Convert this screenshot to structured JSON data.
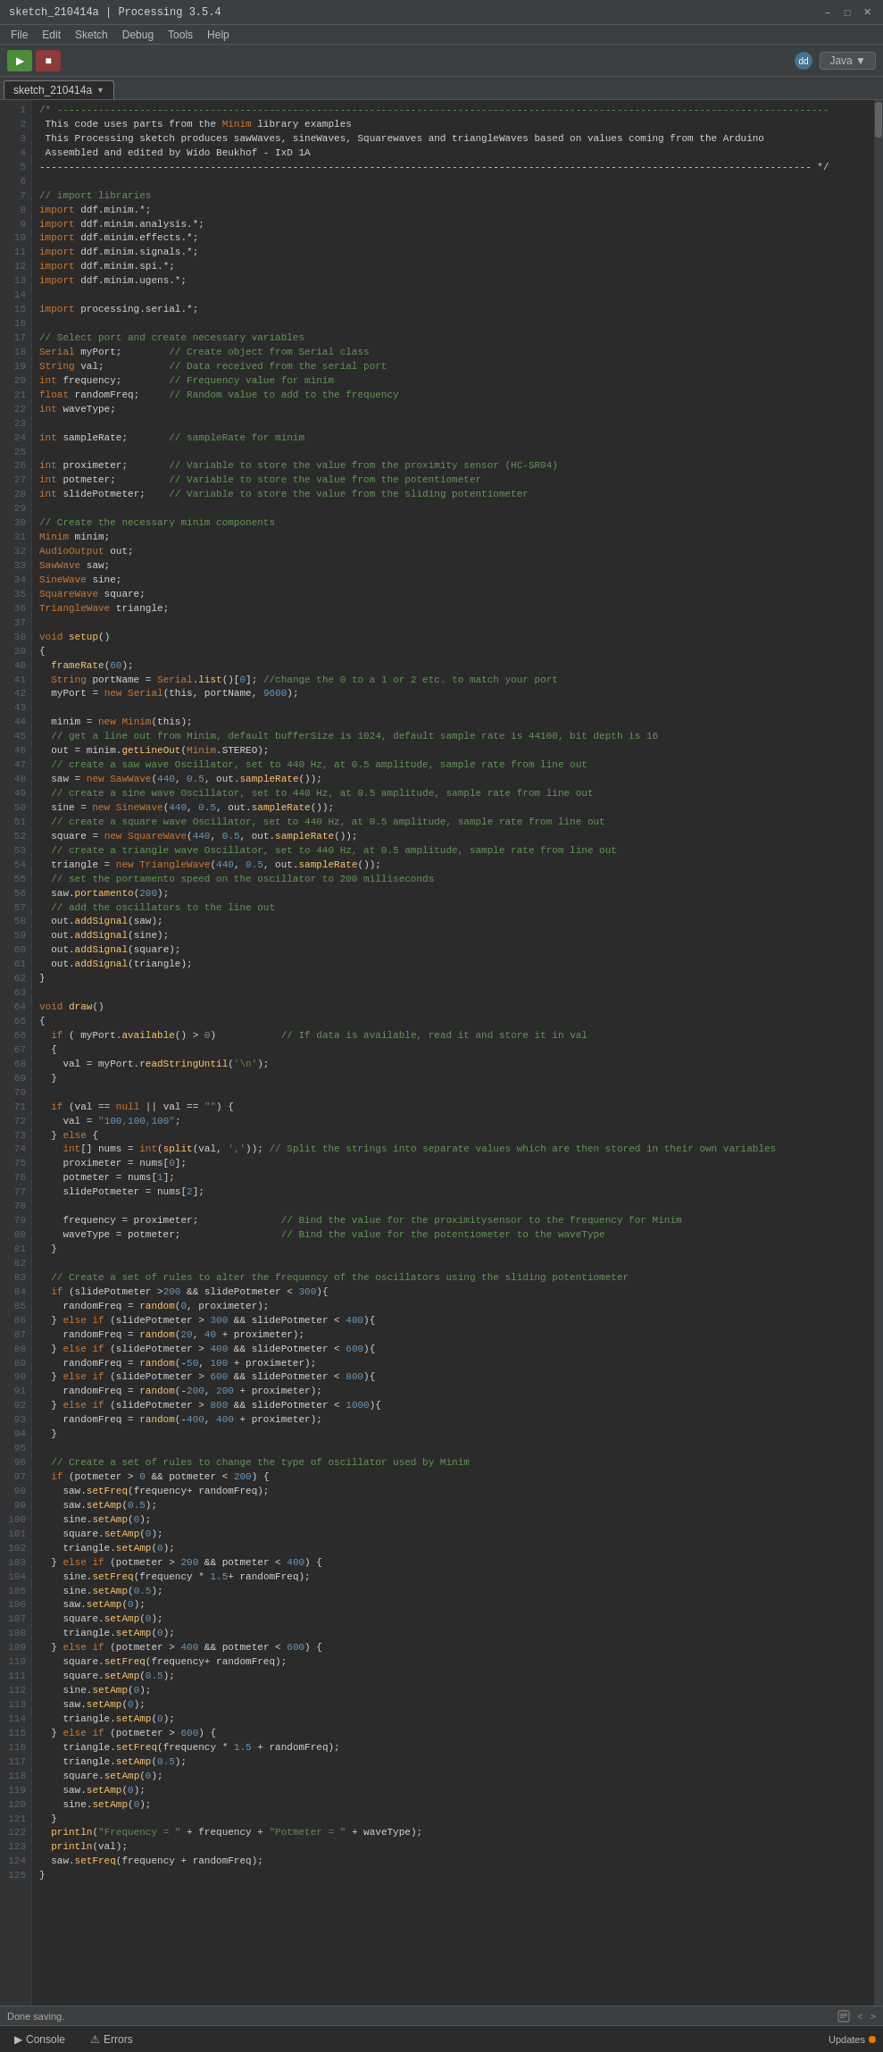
{
  "titlebar": {
    "title": "sketch_210414a | Processing 3.5.4",
    "minimize": "−",
    "maximize": "□",
    "close": "✕"
  },
  "menubar": {
    "items": [
      "File",
      "Edit",
      "Sketch",
      "Debug",
      "Tools",
      "Help"
    ]
  },
  "toolbar": {
    "run_label": "▶",
    "stop_label": "■",
    "java_label": "Java ▼"
  },
  "tab": {
    "name": "sketch_210414a",
    "dropdown": "▼"
  },
  "status": {
    "text": "Done saving."
  },
  "bottom": {
    "console_label": "Console",
    "errors_label": "Errors",
    "updates_label": "Updates"
  },
  "code_lines": [
    {
      "n": 1,
      "text": "/* -----------------------------------------------------------------------------------------------------------------------------------"
    },
    {
      "n": 2,
      "text": " This code uses parts from the Minim library examples"
    },
    {
      "n": 3,
      "text": " This Processing sketch produces sawWaves, sineWaves, Squarewaves and triangleWaves based on values coming from the Arduino"
    },
    {
      "n": 4,
      "text": " Assembled and edited by Wido Beukhof - IxD 1A"
    },
    {
      "n": 5,
      "text": "----------------------------------------------------------------------------------------------------------------------------------- */"
    },
    {
      "n": 6,
      "text": ""
    },
    {
      "n": 7,
      "text": "// import libraries"
    },
    {
      "n": 8,
      "text": "import ddf.minim.*;"
    },
    {
      "n": 9,
      "text": "import ddf.minim.analysis.*;"
    },
    {
      "n": 10,
      "text": "import ddf.minim.effects.*;"
    },
    {
      "n": 11,
      "text": "import ddf.minim.signals.*;"
    },
    {
      "n": 12,
      "text": "import ddf.minim.spi.*;"
    },
    {
      "n": 13,
      "text": "import ddf.minim.ugens.*;"
    },
    {
      "n": 14,
      "text": ""
    },
    {
      "n": 15,
      "text": "import processing.serial.*;"
    },
    {
      "n": 16,
      "text": ""
    },
    {
      "n": 17,
      "text": "// Select port and create necessary variables"
    },
    {
      "n": 18,
      "text": "Serial myPort;        // Create object from Serial class"
    },
    {
      "n": 19,
      "text": "String val;           // Data received from the serial port"
    },
    {
      "n": 20,
      "text": "int frequency;        // Frequency value for minim"
    },
    {
      "n": 21,
      "text": "float randomFreq;     // Random value to add to the frequency"
    },
    {
      "n": 22,
      "text": "int waveType;"
    },
    {
      "n": 23,
      "text": ""
    },
    {
      "n": 24,
      "text": "int sampleRate;       // sampleRate for minim"
    },
    {
      "n": 25,
      "text": ""
    },
    {
      "n": 26,
      "text": "int proximeter;       // Variable to store the value from the proximity sensor (HC-SR04)"
    },
    {
      "n": 27,
      "text": "int potmeter;         // Variable to store the value from the potentiometer"
    },
    {
      "n": 28,
      "text": "int slidePotmeter;    // Variable to store the value from the sliding potentiometer"
    },
    {
      "n": 29,
      "text": ""
    },
    {
      "n": 30,
      "text": "// Create the necessary minim components"
    },
    {
      "n": 31,
      "text": "Minim minim;"
    },
    {
      "n": 32,
      "text": "AudioOutput out;"
    },
    {
      "n": 33,
      "text": "SawWave saw;"
    },
    {
      "n": 34,
      "text": "SineWave sine;"
    },
    {
      "n": 35,
      "text": "SquareWave square;"
    },
    {
      "n": 36,
      "text": "TriangleWave triangle;"
    },
    {
      "n": 37,
      "text": ""
    },
    {
      "n": 38,
      "text": "void setup()"
    },
    {
      "n": 39,
      "text": "{"
    },
    {
      "n": 40,
      "text": "  frameRate(60);"
    },
    {
      "n": 41,
      "text": "  String portName = Serial.list()[0]; //change the 0 to a 1 or 2 etc. to match your port"
    },
    {
      "n": 42,
      "text": "  myPort = new Serial(this, portName, 9600);"
    },
    {
      "n": 43,
      "text": ""
    },
    {
      "n": 44,
      "text": "  minim = new Minim(this);"
    },
    {
      "n": 45,
      "text": "  // get a line out from Minim, default bufferSize is 1024, default sample rate is 44100, bit depth is 16"
    },
    {
      "n": 46,
      "text": "  out = minim.getLineOut(Minim.STEREO);"
    },
    {
      "n": 47,
      "text": "  // create a saw wave Oscillator, set to 440 Hz, at 0.5 amplitude, sample rate from line out"
    },
    {
      "n": 48,
      "text": "  saw = new SawWave(440, 0.5, out.sampleRate());"
    },
    {
      "n": 49,
      "text": "  // create a sine wave Oscillator, set to 440 Hz, at 0.5 amplitude, sample rate from line out"
    },
    {
      "n": 50,
      "text": "  sine = new SineWave(440, 0.5, out.sampleRate());"
    },
    {
      "n": 51,
      "text": "  // create a square wave Oscillator, set to 440 Hz, at 0.5 amplitude, sample rate from line out"
    },
    {
      "n": 52,
      "text": "  square = new SquareWave(440, 0.5, out.sampleRate());"
    },
    {
      "n": 53,
      "text": "  // create a triangle wave Oscillator, set to 440 Hz, at 0.5 amplitude, sample rate from line out"
    },
    {
      "n": 54,
      "text": "  triangle = new TriangleWave(440, 0.5, out.sampleRate());"
    },
    {
      "n": 55,
      "text": "  // set the portamento speed on the oscillator to 200 milliseconds"
    },
    {
      "n": 56,
      "text": "  saw.portamento(200);"
    },
    {
      "n": 57,
      "text": "  // add the oscillators to the line out"
    },
    {
      "n": 58,
      "text": "  out.addSignal(saw);"
    },
    {
      "n": 59,
      "text": "  out.addSignal(sine);"
    },
    {
      "n": 60,
      "text": "  out.addSignal(square);"
    },
    {
      "n": 61,
      "text": "  out.addSignal(triangle);"
    },
    {
      "n": 62,
      "text": "}"
    },
    {
      "n": 63,
      "text": ""
    },
    {
      "n": 64,
      "text": "void draw()"
    },
    {
      "n": 65,
      "text": "{"
    },
    {
      "n": 66,
      "text": "  if ( myPort.available() > 0)           // If data is available, read it and store it in val"
    },
    {
      "n": 67,
      "text": "  {"
    },
    {
      "n": 68,
      "text": "    val = myPort.readStringUntil('\\n');"
    },
    {
      "n": 69,
      "text": "  }"
    },
    {
      "n": 70,
      "text": ""
    },
    {
      "n": 71,
      "text": "  if (val == null || val == \"\") {"
    },
    {
      "n": 72,
      "text": "    val = \"100,100,100\";"
    },
    {
      "n": 73,
      "text": "  } else {"
    },
    {
      "n": 74,
      "text": "    int[] nums = int(split(val, ',')); // Split the strings into separate values which are then stored in their own variables"
    },
    {
      "n": 75,
      "text": "    proximeter = nums[0];"
    },
    {
      "n": 76,
      "text": "    potmeter = nums[1];"
    },
    {
      "n": 77,
      "text": "    slidePotmeter = nums[2];"
    },
    {
      "n": 78,
      "text": ""
    },
    {
      "n": 79,
      "text": "    frequency = proximeter;              // Bind the value for the proximitysensor to the frequency for Minim"
    },
    {
      "n": 80,
      "text": "    waveType = potmeter;                 // Bind the value for the potentiometer to the waveType"
    },
    {
      "n": 81,
      "text": "  }"
    },
    {
      "n": 82,
      "text": ""
    },
    {
      "n": 83,
      "text": "  // Create a set of rules to alter the frequency of the oscillators using the sliding potentiometer"
    },
    {
      "n": 84,
      "text": "  if (slidePotmeter >200 && slidePotmeter < 300){"
    },
    {
      "n": 85,
      "text": "    randomFreq = random(0, proximeter);"
    },
    {
      "n": 86,
      "text": "  } else if (slidePotmeter > 300 && slidePotmeter < 400){"
    },
    {
      "n": 87,
      "text": "    randomFreq = random(20, 40 + proximeter);"
    },
    {
      "n": 88,
      "text": "  } else if (slidePotmeter > 400 && slidePotmeter < 600){"
    },
    {
      "n": 89,
      "text": "    randomFreq = random(-50, 100 + proximeter);"
    },
    {
      "n": 90,
      "text": "  } else if (slidePotmeter > 600 && slidePotmeter < 800){"
    },
    {
      "n": 91,
      "text": "    randomFreq = random(-200, 200 + proximeter);"
    },
    {
      "n": 92,
      "text": "  } else if (slidePotmeter > 800 && slidePotmeter < 1000){"
    },
    {
      "n": 93,
      "text": "    randomFreq = random(-400, 400 + proximeter);"
    },
    {
      "n": 94,
      "text": "  }"
    },
    {
      "n": 95,
      "text": ""
    },
    {
      "n": 96,
      "text": "  // Create a set of rules to change the type of oscillator used by Minim"
    },
    {
      "n": 97,
      "text": "  if (potmeter > 0 && potmeter < 200) {"
    },
    {
      "n": 98,
      "text": "    saw.setFreq(frequency+ randomFreq);"
    },
    {
      "n": 99,
      "text": "    saw.setAmp(0.5);"
    },
    {
      "n": 100,
      "text": "    sine.setAmp(0);"
    },
    {
      "n": 101,
      "text": "    square.setAmp(0);"
    },
    {
      "n": 102,
      "text": "    triangle.setAmp(0);"
    },
    {
      "n": 103,
      "text": "  } else if (potmeter > 200 && potmeter < 400) {"
    },
    {
      "n": 104,
      "text": "    sine.setFreq(frequency * 1.5+ randomFreq);"
    },
    {
      "n": 105,
      "text": "    sine.setAmp(0.5);"
    },
    {
      "n": 106,
      "text": "    saw.setAmp(0);"
    },
    {
      "n": 107,
      "text": "    square.setAmp(0);"
    },
    {
      "n": 108,
      "text": "    triangle.setAmp(0);"
    },
    {
      "n": 109,
      "text": "  } else if (potmeter > 400 && potmeter < 600) {"
    },
    {
      "n": 110,
      "text": "    square.setFreq(frequency+ randomFreq);"
    },
    {
      "n": 111,
      "text": "    square.setAmp(0.5);"
    },
    {
      "n": 112,
      "text": "    sine.setAmp(0);"
    },
    {
      "n": 113,
      "text": "    saw.setAmp(0);"
    },
    {
      "n": 114,
      "text": "    triangle.setAmp(0);"
    },
    {
      "n": 115,
      "text": "  } else if (potmeter > 600) {"
    },
    {
      "n": 116,
      "text": "    triangle.setFreq(frequency * 1.5 + randomFreq);"
    },
    {
      "n": 117,
      "text": "    triangle.setAmp(0.5);"
    },
    {
      "n": 118,
      "text": "    square.setAmp(0);"
    },
    {
      "n": 119,
      "text": "    saw.setAmp(0);"
    },
    {
      "n": 120,
      "text": "    sine.setAmp(0);"
    },
    {
      "n": 121,
      "text": "  }"
    },
    {
      "n": 122,
      "text": "  println(\"Frequency = \" + frequency + \"Potmeter = \" + waveType);"
    },
    {
      "n": 123,
      "text": "  println(val);"
    },
    {
      "n": 124,
      "text": "  saw.setFreq(frequency + randomFreq);"
    },
    {
      "n": 125,
      "text": "}"
    }
  ]
}
